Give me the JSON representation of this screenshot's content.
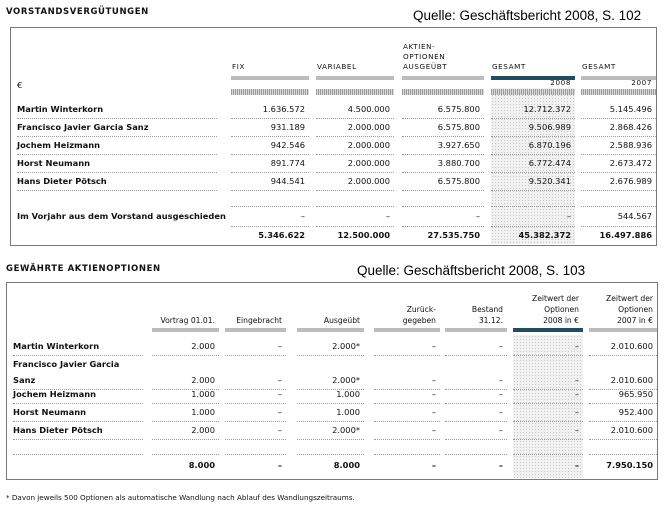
{
  "table1": {
    "title": "VORSTANDSVERGÜTUNGEN",
    "source": "Quelle: Geschäftsbericht 2008, S. 102",
    "unit": "€",
    "headers": [
      {
        "lines": [
          "FIX"
        ],
        "sub": ""
      },
      {
        "lines": [
          "VARIABEL"
        ],
        "sub": ""
      },
      {
        "lines": [
          "AKTIEN-",
          "OPTIONEN",
          "AUSGEÜBT"
        ],
        "sub": ""
      },
      {
        "lines": [
          "GESAMT"
        ],
        "sub": "2008"
      },
      {
        "lines": [
          "GESAMT"
        ],
        "sub": "2007"
      }
    ],
    "rows": [
      {
        "name": "Martin Winterkorn",
        "values": [
          "1.636.572",
          "4.500.000",
          "6.575.800",
          "12.712.372",
          "5.145.496"
        ]
      },
      {
        "name": "Francisco Javier Garcia Sanz",
        "values": [
          "931.189",
          "2.000.000",
          "6.575.800",
          "9.506.989",
          "2.868.426"
        ]
      },
      {
        "name": "Jochem Heizmann",
        "values": [
          "942.546",
          "2.000.000",
          "3.927.650",
          "6.870.196",
          "2.588.936"
        ]
      },
      {
        "name": "Horst Neumann",
        "values": [
          "891.774",
          "2.000.000",
          "3.880.700",
          "6.772.474",
          "2.673.472"
        ]
      },
      {
        "name": "Hans Dieter Pötsch",
        "values": [
          "944.541",
          "2.000.000",
          "6.575.800",
          "9.520.341",
          "2.676.989"
        ]
      }
    ],
    "former": {
      "name": "Im Vorjahr aus dem Vorstand ausgeschieden",
      "values": [
        "–",
        "–",
        "–",
        "–",
        "544.567"
      ]
    },
    "totals": [
      "5.346.622",
      "12.500.000",
      "27.535.750",
      "45.382.372",
      "16.497.886"
    ]
  },
  "table2": {
    "title": "GEWÄHRTE AKTIENOPTIONEN",
    "source": "Quelle: Geschäftsbericht 2008, S. 103",
    "headers": [
      {
        "lines": [
          "Vortrag 01.01."
        ]
      },
      {
        "lines": [
          "Eingebracht"
        ]
      },
      {
        "lines": [
          "Ausgeübt"
        ]
      },
      {
        "lines": [
          "Zurück-",
          "gegeben"
        ]
      },
      {
        "lines": [
          "Bestand",
          "31.12."
        ]
      },
      {
        "lines": [
          "Zeitwert der",
          "Optionen",
          "2008 in €"
        ]
      },
      {
        "lines": [
          "Zeitwert der",
          "Optionen",
          "2007 in €"
        ]
      }
    ],
    "rows": [
      {
        "name": [
          "Martin Winterkorn"
        ],
        "values": [
          "2.000",
          "–",
          "2.000*",
          "–",
          "–",
          "–",
          "2.010.600"
        ]
      },
      {
        "name": [
          "Francisco Javier Garcia",
          "Sanz"
        ],
        "values": [
          "2.000",
          "–",
          "2.000*",
          "–",
          "–",
          "–",
          "2.010.600"
        ]
      },
      {
        "name": [
          "Jochem Heizmann"
        ],
        "values": [
          "1.000",
          "–",
          "1.000",
          "–",
          "–",
          "–",
          "965.950"
        ]
      },
      {
        "name": [
          "Horst Neumann"
        ],
        "values": [
          "1.000",
          "–",
          "1.000",
          "–",
          "–",
          "–",
          "952.400"
        ]
      },
      {
        "name": [
          "Hans Dieter Pötsch"
        ],
        "values": [
          "2.000",
          "–",
          "2.000*",
          "–",
          "–",
          "–",
          "2.010.600"
        ]
      }
    ],
    "totals": [
      "8.000",
      "–",
      "8.000",
      "–",
      "–",
      "–",
      "7.950.150"
    ],
    "footnote": "*   Davon jeweils 500 Optionen als automatische Wandlung nach Ablauf des Wandlungszeitraums."
  }
}
